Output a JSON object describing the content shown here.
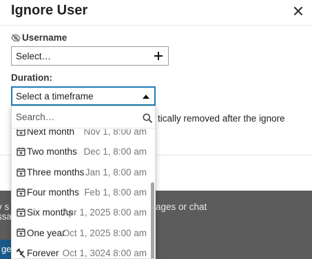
{
  "modal": {
    "title": "Ignore User",
    "username_label": "Username",
    "username_select_value": "Select…",
    "duration_label": "Duration:",
    "duration_select_value": "Select a timeframe",
    "note_fragment": "tically removed after the ignore"
  },
  "dropdown": {
    "search_placeholder": "Search…",
    "options": [
      {
        "label": "Next month",
        "date": "Nov 1, 8:00 am",
        "icon": "calendar-plus-icon"
      },
      {
        "label": "Two months",
        "date": "Dec 1, 8:00 am",
        "icon": "calendar-plus-icon"
      },
      {
        "label": "Three months",
        "date": "Jan 1, 8:00 am",
        "icon": "calendar-plus-icon"
      },
      {
        "label": "Four months",
        "date": "Feb 1, 8:00 am",
        "icon": "calendar-plus-icon"
      },
      {
        "label": "Six months",
        "date": "Apr 1, 2025 8:00 am",
        "icon": "calendar-plus-icon"
      },
      {
        "label": "One year",
        "date": "Oct 1, 2025 8:00 am",
        "icon": "calendar-plus-icon"
      },
      {
        "label": "Forever",
        "date": "Oct 1, 3024 8:00 am",
        "icon": "gavel-icon"
      }
    ]
  },
  "background": {
    "text_left_1": "v s",
    "text_right_1": "ages or chat",
    "text_left_2": "ssa",
    "button_fragment": "ge"
  },
  "colors": {
    "accent": "#1f7cb5",
    "backdrop": "#5c5c5c",
    "secondary_text": "#777777"
  }
}
